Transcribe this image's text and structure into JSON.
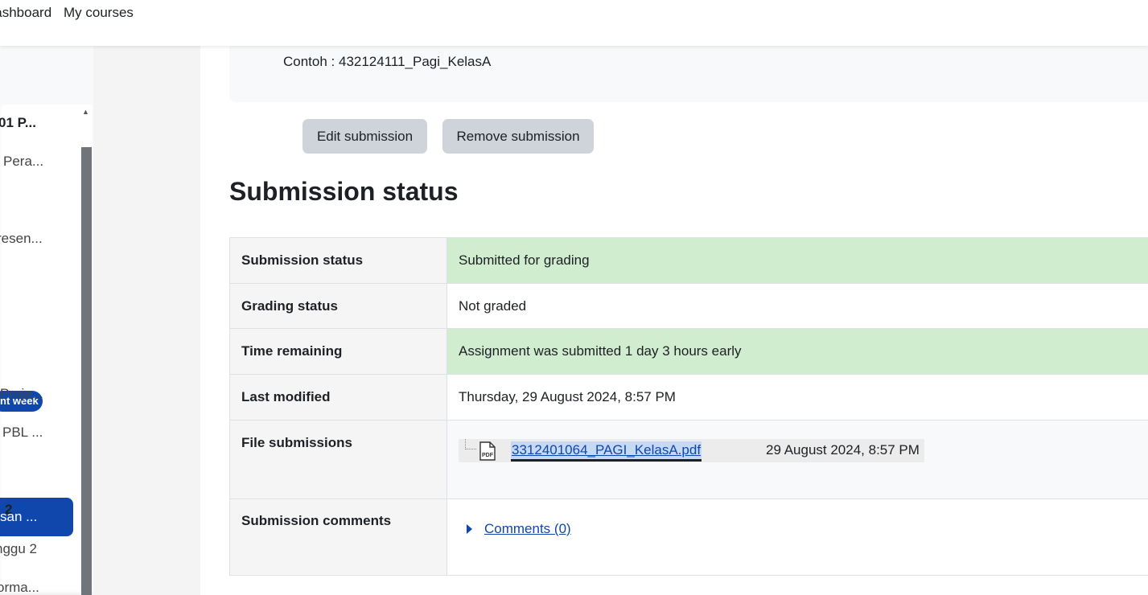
{
  "navbar": {
    "dashboard_label": "Dashboard",
    "my_courses_label": "My courses"
  },
  "drawer": {
    "items": [
      "01 P...",
      "Pera...",
      "resen...",
      "Proje...",
      "PBL ...",
      "2",
      "nggu 2",
      "orma..."
    ],
    "badge": "nt week",
    "active_item": "san ..."
  },
  "intro": {
    "example_text": "Contoh : 432124111_Pagi_KelasA"
  },
  "buttons": {
    "edit": "Edit submission",
    "remove": "Remove submission"
  },
  "section_title": "Submission status",
  "status_table": {
    "rows": [
      {
        "label": "Submission status",
        "value": "Submitted for grading"
      },
      {
        "label": "Grading status",
        "value": "Not graded"
      },
      {
        "label": "Time remaining",
        "value": "Assignment was submitted 1 day 3 hours early"
      },
      {
        "label": "Last modified",
        "value": "Thursday, 29 August 2024, 8:57 PM"
      },
      {
        "label": "File submissions",
        "value": ""
      },
      {
        "label": "Submission comments",
        "value": ""
      }
    ],
    "file": {
      "icon_text": "PDF",
      "name": "3312401064_PAGI_KelasA.pdf",
      "date": "29 August 2024, 8:57 PM"
    },
    "comments_link": "Comments (0)"
  },
  "colors": {
    "primary": "#0f47ad",
    "success_bg": "#d1edcf",
    "button_bg": "#ced4da"
  }
}
